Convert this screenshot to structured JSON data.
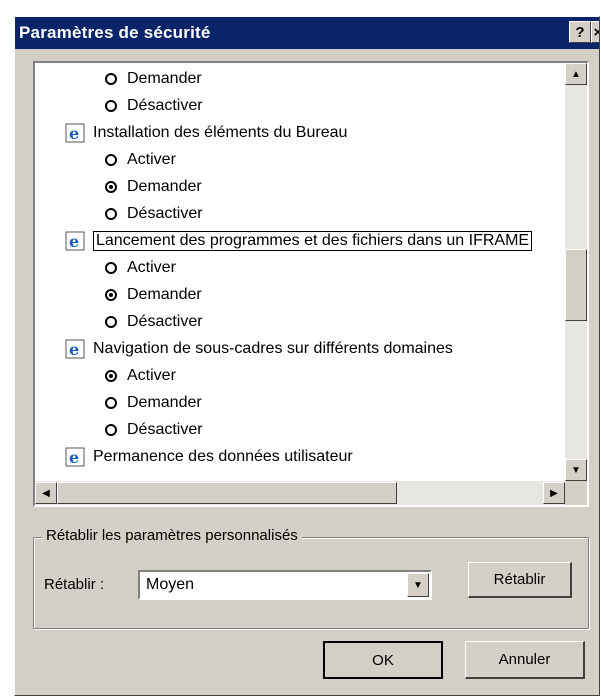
{
  "window": {
    "title": "Paramètres de sécurité",
    "help_glyph": "?",
    "close_glyph": "×"
  },
  "settings_list": {
    "rows": [
      {
        "kind": "option",
        "label": "Demander",
        "selected": false
      },
      {
        "kind": "option",
        "label": "Désactiver",
        "selected": false
      },
      {
        "kind": "category",
        "label": "Installation des éléments du Bureau",
        "icon": "ie-settings-icon"
      },
      {
        "kind": "option",
        "label": "Activer",
        "selected": false
      },
      {
        "kind": "option",
        "label": "Demander",
        "selected": true
      },
      {
        "kind": "option",
        "label": "Désactiver",
        "selected": false
      },
      {
        "kind": "category",
        "label": "Lancement des programmes et des fichiers dans un IFRAME",
        "icon": "ie-settings-icon",
        "focused": true
      },
      {
        "kind": "option",
        "label": "Activer",
        "selected": false
      },
      {
        "kind": "option",
        "label": "Demander",
        "selected": true
      },
      {
        "kind": "option",
        "label": "Désactiver",
        "selected": false
      },
      {
        "kind": "category",
        "label": "Navigation de sous-cadres sur différents domaines",
        "icon": "ie-settings-icon"
      },
      {
        "kind": "option",
        "label": "Activer",
        "selected": true
      },
      {
        "kind": "option",
        "label": "Demander",
        "selected": false
      },
      {
        "kind": "option",
        "label": "Désactiver",
        "selected": false
      },
      {
        "kind": "category",
        "label": "Permanence des données utilisateur",
        "icon": "ie-settings-icon"
      }
    ]
  },
  "reset_group": {
    "legend": "Rétablir les paramètres personnalisés",
    "reset_label": "Rétablir :",
    "level_value": "Moyen",
    "reset_button": "Rétablir"
  },
  "footer": {
    "ok_label": "OK",
    "cancel_label": "Annuler"
  },
  "colors": {
    "titlebar": "#0a246a",
    "face": "#d4d0c8",
    "ie_icon": "#1a5fb4"
  }
}
